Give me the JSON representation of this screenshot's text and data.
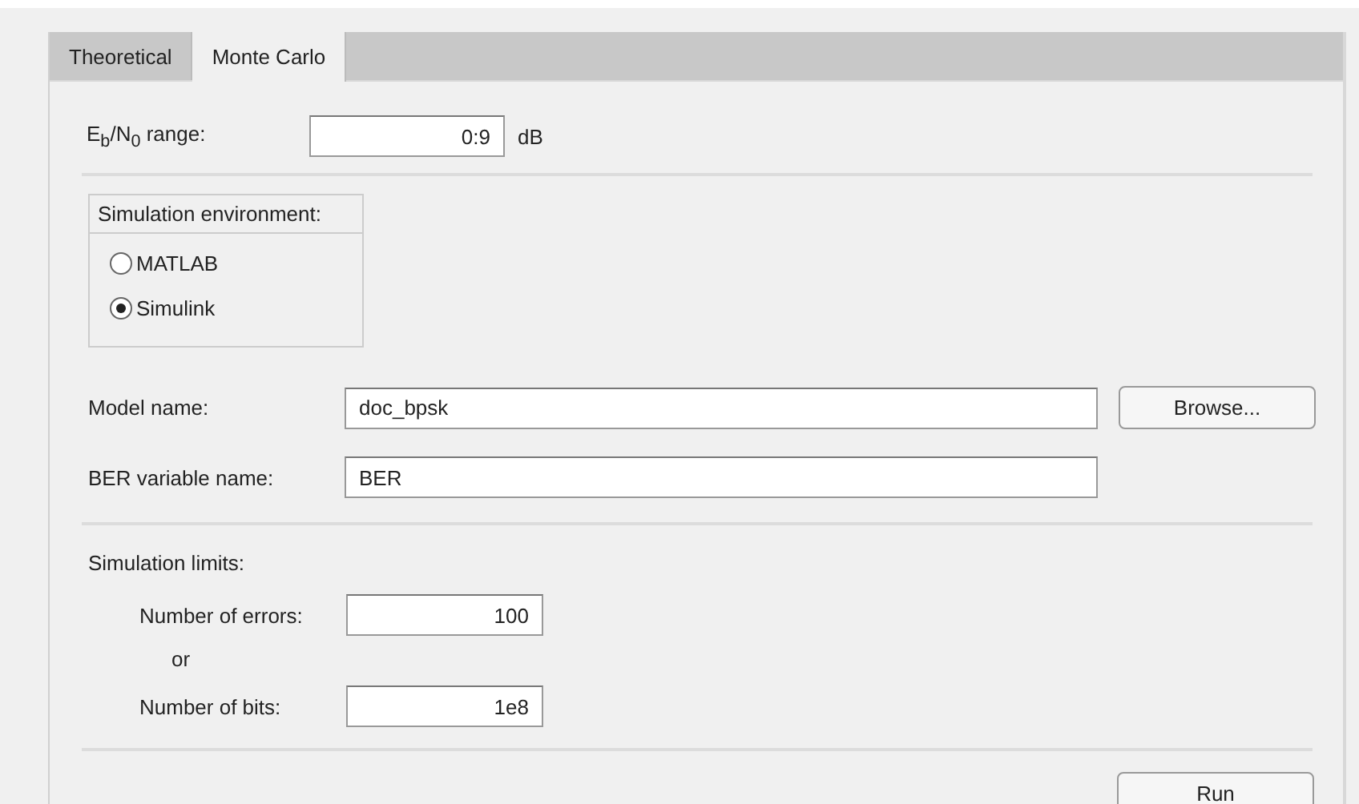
{
  "tabs": [
    {
      "label": "Theoretical",
      "selected": false
    },
    {
      "label": "Monte Carlo",
      "selected": true
    }
  ],
  "range": {
    "label": "E$_{b}$/N$_{0}$ range:",
    "value": "0:9",
    "unit": "dB"
  },
  "environment": {
    "title": "Simulation environment:",
    "options": [
      {
        "label": "MATLAB",
        "selected": false
      },
      {
        "label": "Simulink",
        "selected": true
      }
    ]
  },
  "model": {
    "label": "Model name:",
    "value": "doc_bpsk",
    "button": "Browse..."
  },
  "ber": {
    "label": "BER variable name:",
    "value": "BER"
  },
  "limits": {
    "title": "Simulation limits:",
    "errors_label": "Number of errors:",
    "errors_value": "100",
    "or": "or",
    "bits_label": "Number of bits:",
    "bits_value": "1e8"
  },
  "run_button": "Run"
}
